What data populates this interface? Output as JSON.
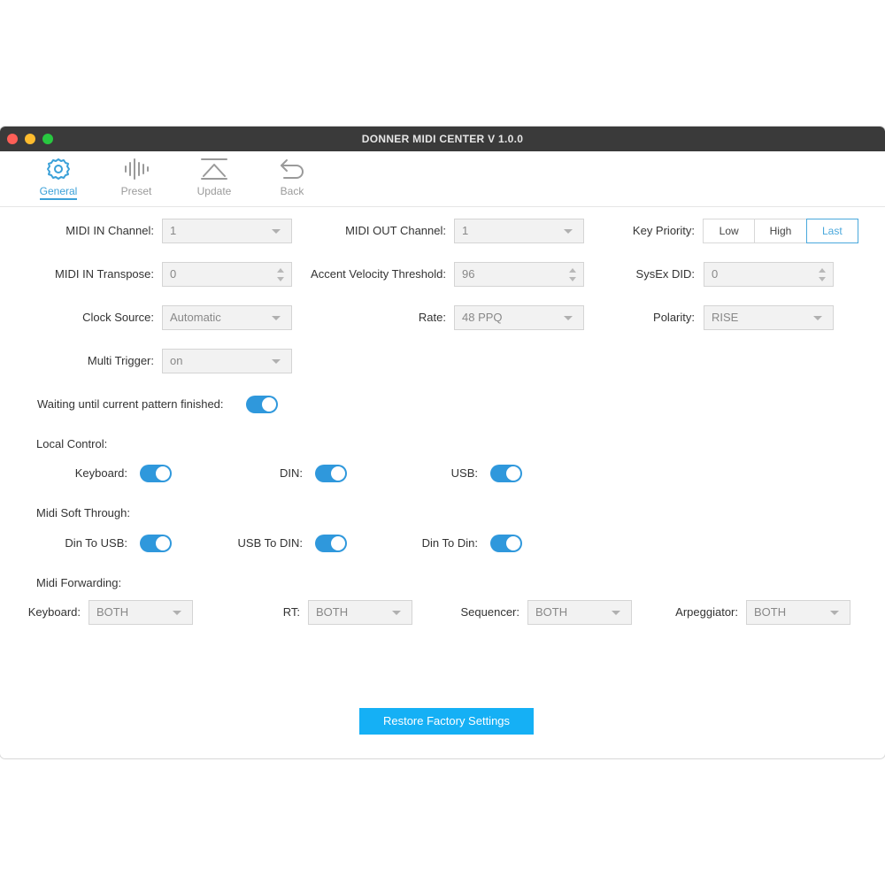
{
  "window": {
    "title": "DONNER MIDI CENTER V 1.0.0"
  },
  "toolbar": {
    "items": [
      {
        "label": "General",
        "icon": "gear-icon",
        "active": true
      },
      {
        "label": "Preset",
        "icon": "waveform-icon"
      },
      {
        "label": "Update",
        "icon": "update-icon"
      },
      {
        "label": "Back",
        "icon": "back-arrow-icon"
      }
    ]
  },
  "settings": {
    "midi_in_channel": {
      "label": "MIDI IN Channel:",
      "value": "1"
    },
    "midi_out_channel": {
      "label": "MIDI OUT Channel:",
      "value": "1"
    },
    "key_priority": {
      "label": "Key Priority:",
      "options": [
        "Low",
        "High",
        "Last"
      ],
      "selected": "Last"
    },
    "midi_in_transpose": {
      "label": "MIDI IN Transpose:",
      "value": "0"
    },
    "accent_velocity": {
      "label": "Accent Velocity Threshold:",
      "value": "96"
    },
    "sysex_did": {
      "label": "SysEx DID:",
      "value": "0"
    },
    "clock_source": {
      "label": "Clock Source:",
      "value": "Automatic"
    },
    "rate": {
      "label": "Rate:",
      "value": "48 PPQ"
    },
    "polarity": {
      "label": "Polarity:",
      "value": "RISE"
    },
    "multi_trigger": {
      "label": "Multi Trigger:",
      "value": "on"
    },
    "waiting": {
      "label": "Waiting until current pattern finished:",
      "on": true
    }
  },
  "local_control": {
    "title": "Local Control:",
    "keyboard": {
      "label": "Keyboard:",
      "on": true
    },
    "din": {
      "label": "DIN:",
      "on": true
    },
    "usb": {
      "label": "USB:",
      "on": true
    }
  },
  "soft_through": {
    "title": "Midi Soft Through:",
    "din_to_usb": {
      "label": "Din To USB:",
      "on": true
    },
    "usb_to_din": {
      "label": "USB To DIN:",
      "on": true
    },
    "din_to_din": {
      "label": "Din To Din:",
      "on": true
    }
  },
  "forwarding": {
    "title": "Midi Forwarding:",
    "keyboard": {
      "label": "Keyboard:",
      "value": "BOTH"
    },
    "rt": {
      "label": "RT:",
      "value": "BOTH"
    },
    "sequencer": {
      "label": "Sequencer:",
      "value": "BOTH"
    },
    "arpeggiator": {
      "label": "Arpeggiator:",
      "value": "BOTH"
    }
  },
  "restore_label": "Restore Factory Settings",
  "colors": {
    "accent": "#2f98dc",
    "button": "#15b0f5",
    "titlebar": "#3a3a3a"
  }
}
